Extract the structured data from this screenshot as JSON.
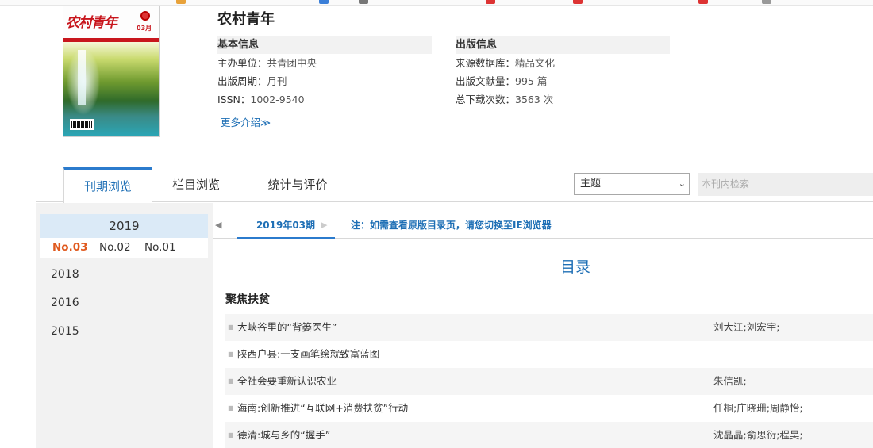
{
  "cover": {
    "title_art": "农村青年",
    "issue_art": "03月"
  },
  "journal": {
    "title": "农村青年",
    "basic": {
      "header": "基本信息",
      "sponsor_label": "主办单位：",
      "sponsor": "共青团中央",
      "cycle_label": "出版周期：",
      "cycle": "月刊",
      "issn_label": "ISSN：",
      "issn": "1002-9540",
      "more": "更多介绍≫"
    },
    "publish": {
      "header": "出版信息",
      "source_label": "来源数据库：",
      "source": "精品文化",
      "count_label": "出版文献量：",
      "count": "995 篇",
      "downloads_label": "总下载次数：",
      "downloads": "3563 次"
    }
  },
  "tabs": [
    {
      "label": "刊期浏览",
      "active": true
    },
    {
      "label": "栏目浏览",
      "active": false
    },
    {
      "label": "统计与评价",
      "active": false
    }
  ],
  "search": {
    "select_value": "主题",
    "placeholder": "本刊内检索"
  },
  "sidebar": {
    "current_year": "2019",
    "issues": [
      {
        "label": "No.03",
        "active": true
      },
      {
        "label": "No.02",
        "active": false
      },
      {
        "label": "No.01",
        "active": false
      }
    ],
    "years": [
      "2018",
      "2016",
      "2015"
    ]
  },
  "main": {
    "issue_label": "2019年03期",
    "note": "注：如需查看原版目录页，请您切换至IE浏览器",
    "toc_title": "目录",
    "section": "聚焦扶贫",
    "articles": [
      {
        "title": "大峡谷里的“背篓医生”",
        "authors": "刘大江;刘宏宇;"
      },
      {
        "title": "陕西户县:一支画笔绘就致富蓝图",
        "authors": ""
      },
      {
        "title": "全社会要重新认识农业",
        "authors": "朱信凯;"
      },
      {
        "title": "海南:创新推进“互联网+消费扶贫”行动",
        "authors": "任桐;庄晓珊;周静怡;"
      },
      {
        "title": "德清:城与乡的“握手”",
        "authors": "沈晶晶;俞思衍;程昊;"
      }
    ]
  }
}
